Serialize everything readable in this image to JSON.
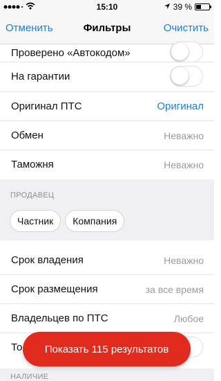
{
  "status_bar": {
    "time": "15:10",
    "battery": "39 %",
    "battery_level": 0.39,
    "icons": [
      "signal-dots-icon",
      "wifi-icon",
      "location-arrow-icon",
      "battery-icon"
    ]
  },
  "nav": {
    "cancel_label": "Отменить",
    "title": "Фильтры",
    "clear_label": "Очистить"
  },
  "rows_top": [
    {
      "label": "Проверено «Автокодом»",
      "toggle": false
    },
    {
      "label": "На гарантии",
      "toggle": false
    },
    {
      "label": "Оригинал ПТС",
      "value": "Оригинал",
      "accent": true
    },
    {
      "label": "Обмен",
      "value": "Неважно"
    },
    {
      "label": "Таможня",
      "value": "Неважно"
    }
  ],
  "seller": {
    "header": "ПРОДАВЕЦ",
    "chips": [
      "Частник",
      "Компания"
    ]
  },
  "rows_bottom": [
    {
      "label": "Срок владения",
      "value": "Неважно"
    },
    {
      "label": "Срок размещения",
      "value": "за все время"
    },
    {
      "label": "Владельцев по ПТС",
      "value": "Любое"
    },
    {
      "label": "То",
      "toggle": false
    }
  ],
  "next_section_header": "НАЛИЧИЕ",
  "show_results_label": "Показать 115 результатов",
  "colors": {
    "accent": "#1a7fd4",
    "cta": "#e02b1e",
    "section_bg": "#efeff4"
  }
}
